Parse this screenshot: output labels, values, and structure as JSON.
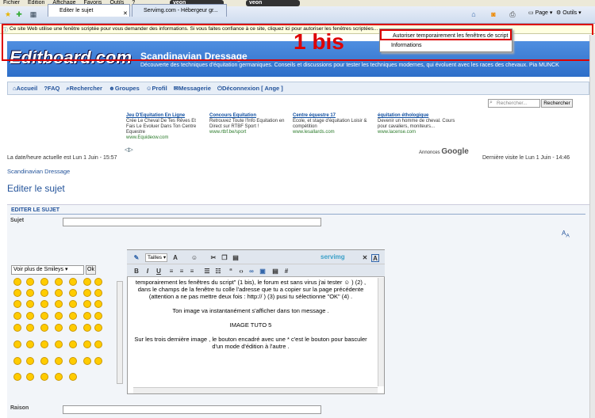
{
  "menu": {
    "items": [
      "Fichier",
      "Edition",
      "Affichage",
      "Favoris",
      "Outils",
      "?"
    ]
  },
  "browser": {
    "veon1": "veon",
    "veon2": "veon",
    "tab1": "Editer le sujet",
    "tab2": "Servimg.com - Hébergeur gr...",
    "page_btn": "Page",
    "tools_btn": "Outils"
  },
  "infobar": {
    "text": "Ce site Web utilise une fenêtre scriptée pour vous demander des informations. Si vous faites confiance à ce site, cliquez ici pour autoriser les fenêtres scriptées..."
  },
  "context_menu": {
    "item1": "Autoriser temporairement les fenêtres de script",
    "item2": "Informations"
  },
  "annotation": {
    "big": "1 bis"
  },
  "site": {
    "logo": "Editboard.com",
    "title": "Scandinavian Dressage",
    "description": "Découverte des techniques d'équitation germaniques. Conseils et discussions pour tester les techniques modernes, qui évoluent avec les races des chevaux. Pia MUNCK"
  },
  "nav": {
    "items": [
      "Accueil",
      "FAQ",
      "Rechercher",
      "Groupes",
      "Profil",
      "Messagerie",
      "Déconnexion [ Ange ]"
    ]
  },
  "search": {
    "placeholder": "Rechercher...",
    "button": "Rechercher"
  },
  "ads": [
    {
      "title": "Jeu D'Equitation En Ligne",
      "text": "Crée Le Cheval De Tes Rêves Et Fais Le Evoluer Dans Ton Centre Equestre",
      "url": "www.Equideow.com"
    },
    {
      "title": "Concours Equitation",
      "text": "Retrouvez Toute l'Info Equitation en Direct sur RTBF Sport !",
      "url": "www.rtbf.be/sport"
    },
    {
      "title": "Centre équestre 17",
      "text": "Ecole, et stage d'équitation Loisir & compétition",
      "url": "www.lesallards.com"
    },
    {
      "title": "équitation éthologique",
      "text": "Devenir un homme de cheval. Cours pour cavaliers, moniteurs...",
      "url": "www.lacense.com"
    }
  ],
  "google": {
    "prefix": "Annonces",
    "brand": "Google"
  },
  "dates": {
    "current": "La date/heure actuelle est Lun 1 Juin - 15:57",
    "last": "Dernière visite le Lun 1 Juin - 14:46"
  },
  "breadcrumb": "Scandinavian Dressage",
  "page_title": "Editer le sujet",
  "form": {
    "section": "EDITER LE SUJET",
    "subject_label": "Sujet",
    "reason_label": "Raison",
    "smilies_select": "Voir plus de Smileys",
    "ok": "Ok"
  },
  "editor": {
    "size_label": "Tailles",
    "servimg": "servimg",
    "lines": [
      "temporairement les fenêtres du script\" (1 bis), le forum est sans virus j'ai tester ☺ ) (2) , dans le champs de la fenêtre tu colle l'adresse que tu a copier sur la page précédente (attention a ne pas mettre deux fois : http:// ) (3) pusi tu sélectionne \"OK\" (4) .",
      "Ton image va instantanément s'afficher dans ton message .",
      "IMAGE TUTO 5",
      "Sur les trois dernière image , le bouton encadré avec une * c'est le bouton pour basculer d'un mode d'édition à l'autre ."
    ]
  },
  "colors": {
    "accent": "#24549b",
    "annotation_red": "#dd0000",
    "header_blue": "#2e6fc9"
  }
}
